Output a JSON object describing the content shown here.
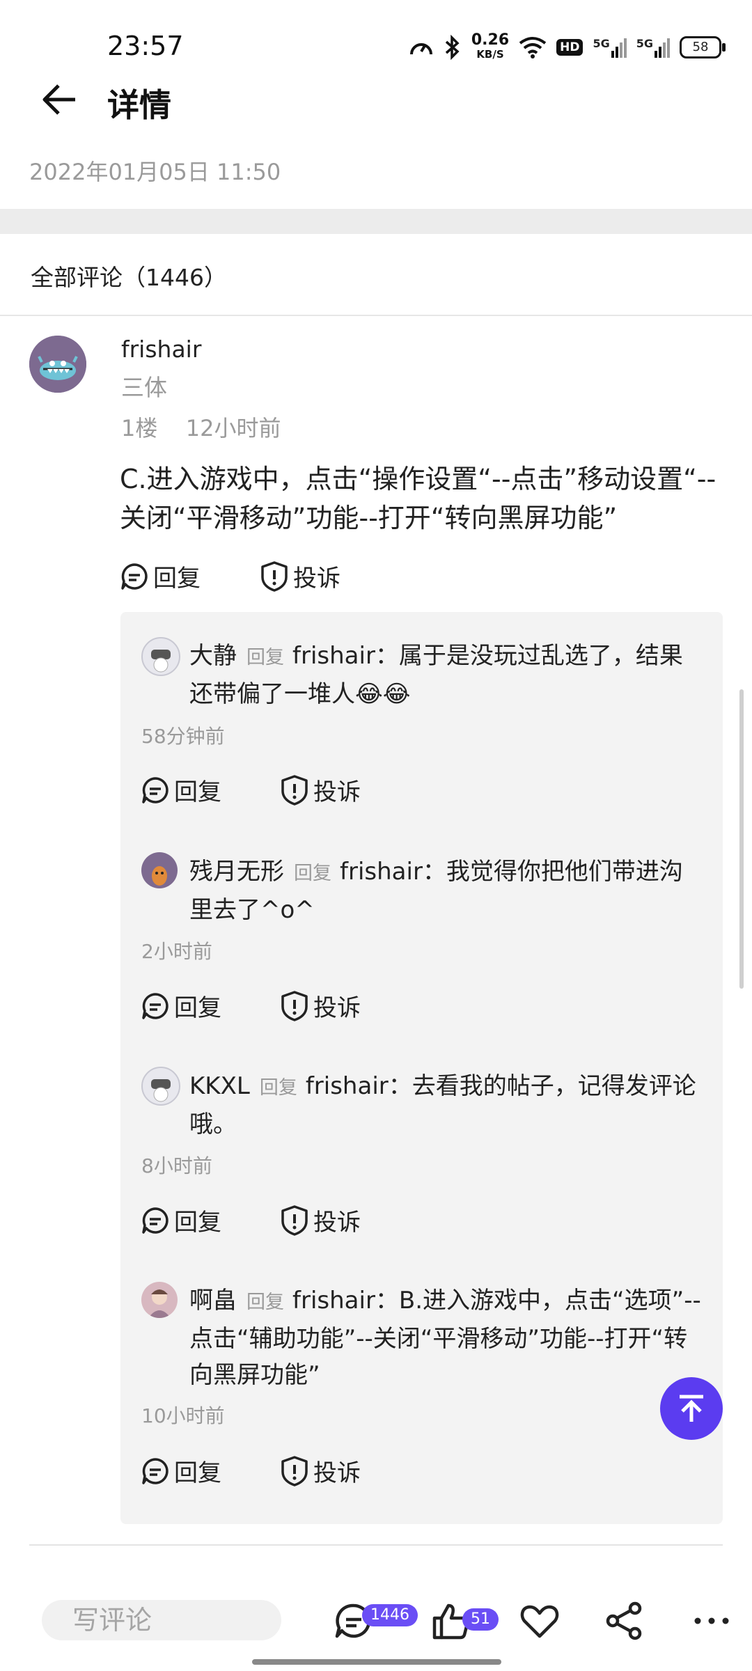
{
  "status_bar": {
    "time": "23:57",
    "net_speed_value": "0.26",
    "net_speed_unit": "KB/S",
    "hd_label": "HD",
    "signal_1": "5G",
    "signal_2": "5G",
    "battery": "58"
  },
  "header": {
    "title": "详情"
  },
  "post": {
    "date": "2022年01月05日 11:50"
  },
  "comments_section": {
    "title": "全部评论（1446）"
  },
  "main_comment": {
    "user": "frishair",
    "tag": "三体",
    "floor": "1楼",
    "time": "12小时前",
    "text": "C.进入游戏中，点击“操作设置“--点击”移动设置“--关闭“平滑移动”功能--打开“转向黑屏功能”",
    "reply_label": "回复",
    "report_label": "投诉"
  },
  "replies": [
    {
      "user": "大静",
      "reply_word": "回复",
      "target": "frishair：",
      "text": "属于是没玩过乱选了，结果还带偏了一堆人😂😂",
      "time": "58分钟前",
      "reply_label": "回复",
      "report_label": "投诉"
    },
    {
      "user": "残月无形",
      "reply_word": "回复",
      "target": "frishair：",
      "text": "我觉得你把他们带进沟里去了^o^",
      "time": "2小时前",
      "reply_label": "回复",
      "report_label": "投诉"
    },
    {
      "user": "KKXL",
      "reply_word": "回复",
      "target": "frishair：",
      "text": "去看我的帖子，记得发评论哦。",
      "time": "8小时前",
      "reply_label": "回复",
      "report_label": "投诉"
    },
    {
      "user": "啊畠",
      "reply_word": "回复",
      "target": "frishair：",
      "text": "B.进入游戏中，点击“选项”--点击“辅助功能”--关闭“平滑移动”功能--打开“转向黑屏功能”",
      "time": "10小时前",
      "reply_label": "回复",
      "report_label": "投诉"
    }
  ],
  "bottom_bar": {
    "comment_placeholder": "写评论",
    "comment_count": "1446",
    "like_count": "51"
  },
  "colors": {
    "accent": "#5b3cf0",
    "badge": "#6a4ef5",
    "muted_text": "#9a9a9a"
  }
}
